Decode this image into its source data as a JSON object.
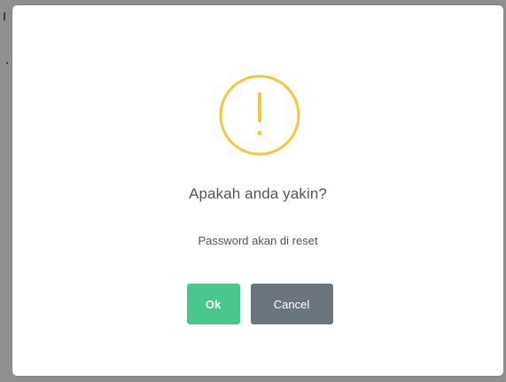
{
  "dialog": {
    "icon": "warning-exclamation-icon",
    "title": "Apakah anda yakin?",
    "message": "Password akan di reset",
    "ok_label": "Ok",
    "cancel_label": "Cancel"
  },
  "colors": {
    "warning": "#f8c53a",
    "ok_button": "#48c78e",
    "cancel_button": "#6c757d",
    "text": "#545454",
    "overlay": "#8f8f8f"
  }
}
